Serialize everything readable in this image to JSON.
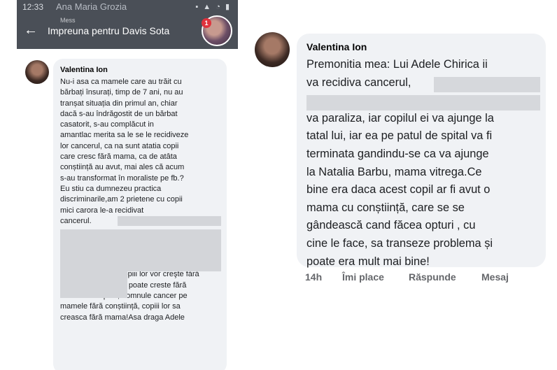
{
  "left": {
    "status_time": "12:33",
    "status_overlay": "Ana Maria Grozia",
    "status_icons": "▪ ▲ ◔ ▮",
    "mess_label": "Mess",
    "chat_title": "Impreuna pentru Davis Sota",
    "notification_count": "1",
    "author": "Valentina Ion",
    "message_lines": [
      "Nu-i asa ca mamele care au trăit cu",
      "bărbați însurați, timp de 7 ani, nu au",
      "tranșat situația din primul an, chiar",
      "dacă s-au îndrăgostit de un bărbat",
      "casatorit, s-au complăcut in",
      "amantlac merita sa le se le recidiveze",
      "lor cancerul, ca na sunt atatia copii",
      "care cresc fără mama, ca de atâta",
      "conștiință au avut, mai ales că acum",
      "s-au transformat în moraliste pe fb.?",
      "Eu stiu ca dumnezeu practica",
      "discriminarile,am 2 prietene cu copii",
      "mici carora le-a recidivat",
      "cancerul.",
      "",
      "",
      "",
      "",
      "                           Copiii lor vor creşte fără",
      "mama,deci și al tău poate creste fără",
      "mama!Fa-le pilaf, domnule cancer pe",
      "mamele fără conștiință, copiii lor sa",
      "creasca fără mama!Asa draga Adele"
    ]
  },
  "right": {
    "author": "Valentina Ion",
    "message_lines": [
      "Premonitia mea: Lui Adele Chirica ii",
      "va recidiva cancerul,",
      "",
      "va paraliza, iar copilul ei va ajunge la",
      "tatal lui, iar ea pe patul de spital va fi",
      "terminata gandindu-se ca va ajunge",
      "la Natalia Barbu, mama vitrega.Ce",
      "bine era daca acest copil ar fi avut o",
      "mama cu conștiință, care se se",
      "gândească cand făcea opturi , cu",
      "cine le face, sa transeze problema și",
      "poate era mult mai bine!"
    ],
    "actions": {
      "time": "14h",
      "like": "Îmi place",
      "reply": "Răspunde",
      "message": "Mesaj"
    }
  }
}
